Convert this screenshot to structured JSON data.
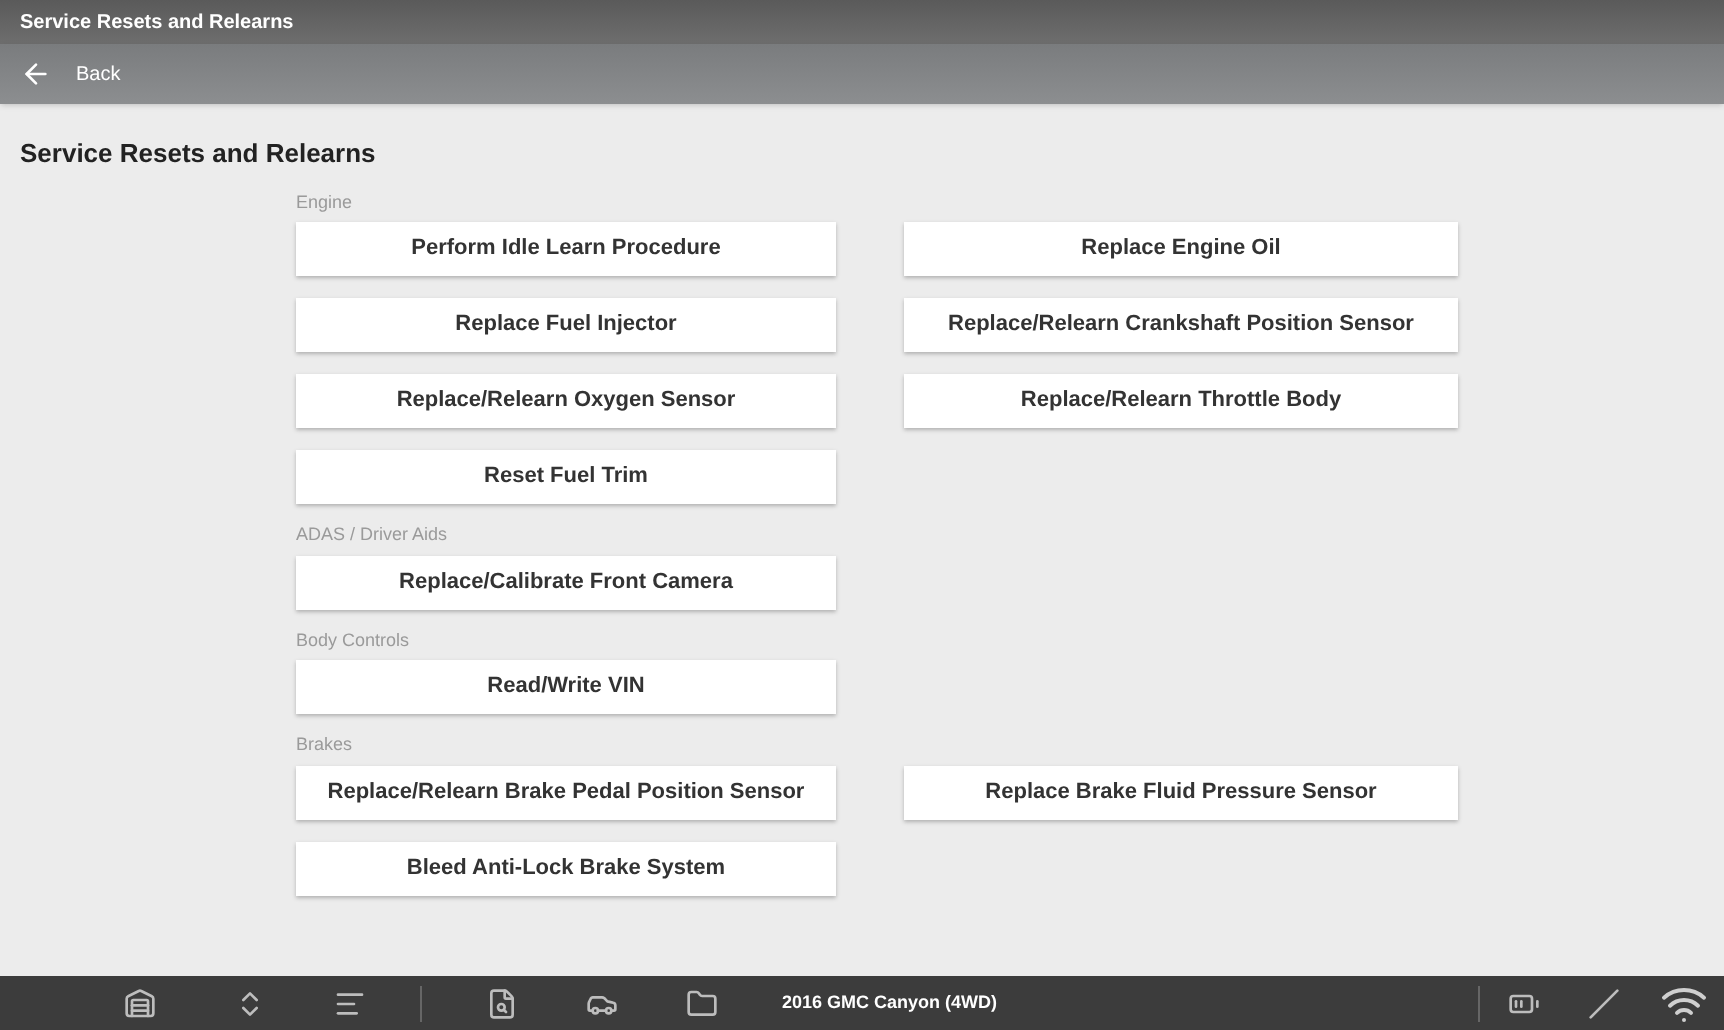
{
  "window": {
    "title": "Service Resets and Relearns"
  },
  "nav": {
    "back": "Back"
  },
  "heading": "Service Resets and Relearns",
  "sections": [
    {
      "title": "Engine",
      "buttons": [
        "Perform Idle Learn Procedure",
        "Replace Engine Oil",
        "Replace Fuel Injector",
        "Replace/Relearn Crankshaft Position Sensor",
        "Replace/Relearn Oxygen Sensor",
        "Replace/Relearn Throttle Body",
        "Reset Fuel Trim"
      ]
    },
    {
      "title": "ADAS / Driver Aids",
      "buttons": [
        "Replace/Calibrate Front Camera"
      ]
    },
    {
      "title": "Body Controls",
      "buttons": [
        "Read/Write VIN"
      ]
    },
    {
      "title": "Brakes",
      "buttons": [
        "Replace/Relearn Brake Pedal Position Sensor",
        "Replace Brake Fluid Pressure Sensor",
        "Bleed Anti-Lock Brake System"
      ]
    }
  ],
  "status_bar": {
    "vehicle": "2016 GMC Canyon (4WD)"
  }
}
